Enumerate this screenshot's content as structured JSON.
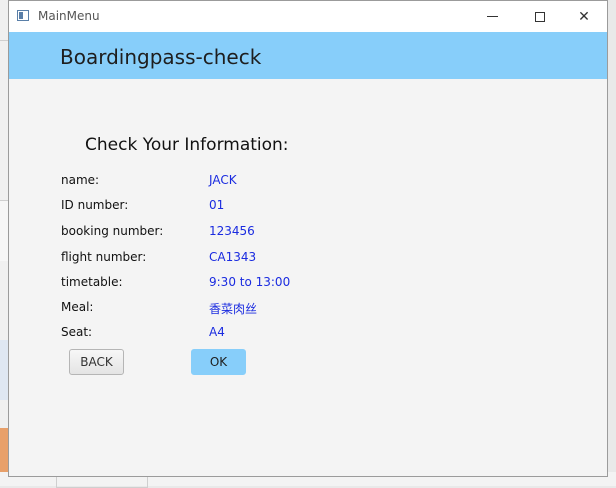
{
  "window": {
    "title": "MainMenu",
    "controls": {
      "minimize": "—",
      "maximize": "☐",
      "close": "✕"
    }
  },
  "header": {
    "title": "Boardingpass-check"
  },
  "section": {
    "title": "Check Your Information:"
  },
  "info_rows": [
    {
      "label": "name:",
      "value": "JACK"
    },
    {
      "label": "ID number:",
      "value": "01"
    },
    {
      "label": "booking number:",
      "value": "123456"
    },
    {
      "label": "flight number:",
      "value": "CA1343"
    },
    {
      "label": "timetable:",
      "value": "9:30 to 13:00"
    },
    {
      "label": "Meal:",
      "value": "香菜肉丝"
    },
    {
      "label": "Seat:",
      "value": "A4"
    }
  ],
  "buttons": {
    "back": "BACK",
    "ok": "OK"
  },
  "colors": {
    "header_bg": "#87cefa",
    "value_text": "#1a2be0",
    "ok_bg": "#87cefa"
  }
}
